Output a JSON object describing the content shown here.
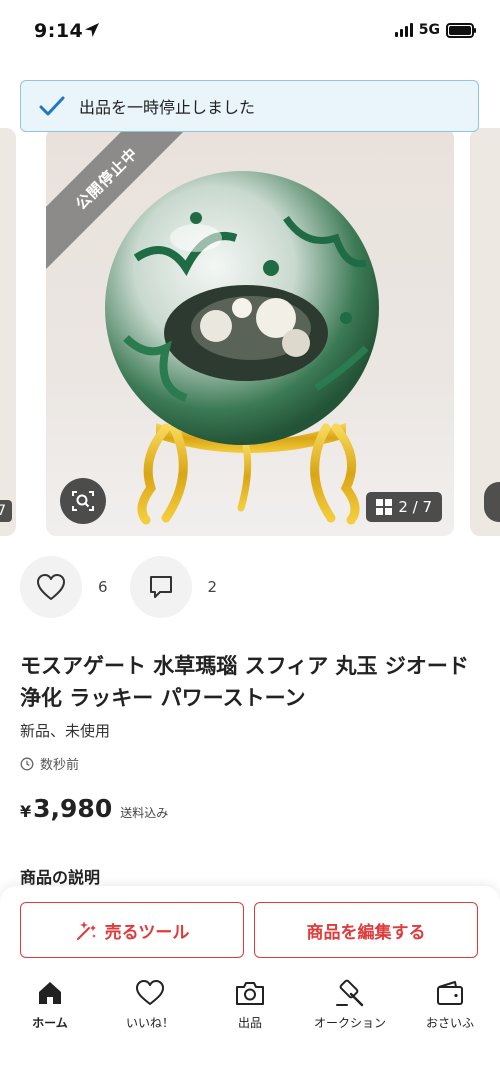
{
  "status_bar": {
    "time": "9:14",
    "network": "5G"
  },
  "toast": {
    "message": "出品を一時停止しました"
  },
  "gallery": {
    "ribbon": "公開停止中",
    "page_indicator": "2 / 7",
    "left_peek_badge": "7",
    "current_page": 2,
    "total_pages": 7
  },
  "actions": {
    "likes": "6",
    "comments": "2"
  },
  "item": {
    "title": "モスアゲート 水草瑪瑙 スフィア 丸玉 ジオード 浄化 ラッキー パワーストーン",
    "condition": "新品、未使用",
    "posted": "数秒前",
    "currency": "¥",
    "price": "3,980",
    "shipping": "送料込み",
    "description_heading": "商品の説明"
  },
  "buttons": {
    "sell_tool": "売るツール",
    "edit_item": "商品を編集する"
  },
  "tabbar": {
    "items": [
      {
        "label": "ホーム",
        "icon": "home-icon",
        "active": true
      },
      {
        "label": "いいね！",
        "icon": "heart-icon",
        "active": false
      },
      {
        "label": "出品",
        "icon": "camera-icon",
        "active": false
      },
      {
        "label": "オークション",
        "icon": "gavel-icon",
        "active": false
      },
      {
        "label": "おさいふ",
        "icon": "wallet-icon",
        "active": false
      }
    ]
  },
  "colors": {
    "accent": "#e03b3b",
    "toast_bg": "#e9f4fb",
    "toast_border": "#8fc4e2",
    "check": "#1f78c1"
  }
}
